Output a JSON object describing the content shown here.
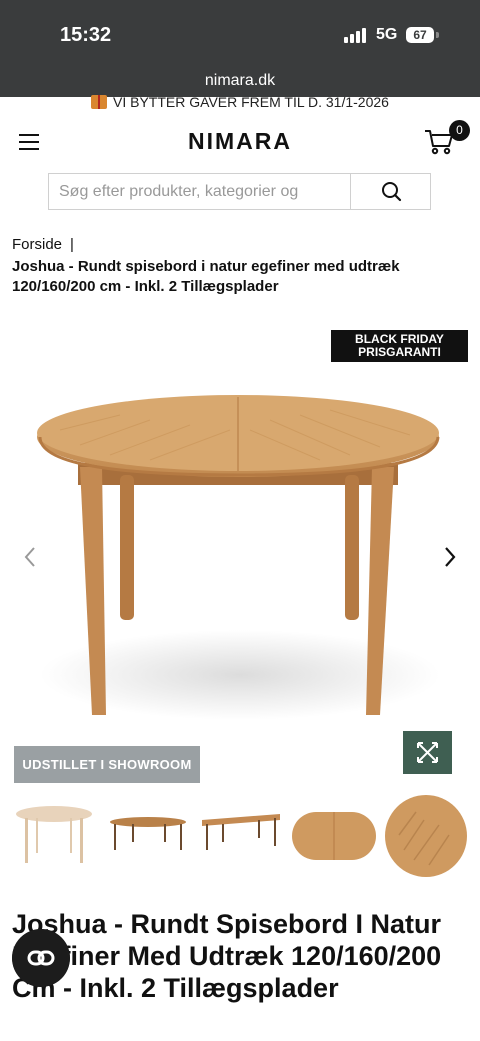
{
  "status_bar": {
    "time": "15:32",
    "network": "5G",
    "battery": "67"
  },
  "browser": {
    "url": "nimara.dk"
  },
  "promo": {
    "text": "VI BYTTER GAVER FREM TIL D. 31/1-2026"
  },
  "header": {
    "logo": "NIMARA",
    "cart_count": "0"
  },
  "search": {
    "placeholder": "Søg efter produkter, kategorier og"
  },
  "breadcrumb": {
    "home": "Forside",
    "separator": "|",
    "current": "Joshua - Rundt spisebord i natur egefiner med udtræk 120/160/200 cm - Inkl. 2 Tillægsplader"
  },
  "product": {
    "badge_line1": "BLACK FRIDAY",
    "badge_line2": "PRISGARANTI",
    "showroom_label": "UDSTILLET I SHOWROOM",
    "title": "Joshua - Rundt Spisebord I Natur Egefiner Med Udtræk 120/160/200 Cm - Inkl. 2 Tillægsplader"
  },
  "colors": {
    "dark_bar": "#3a3c3d",
    "accent_green": "#3f5f52",
    "oak": "#c9935a",
    "badge": "#111111"
  }
}
